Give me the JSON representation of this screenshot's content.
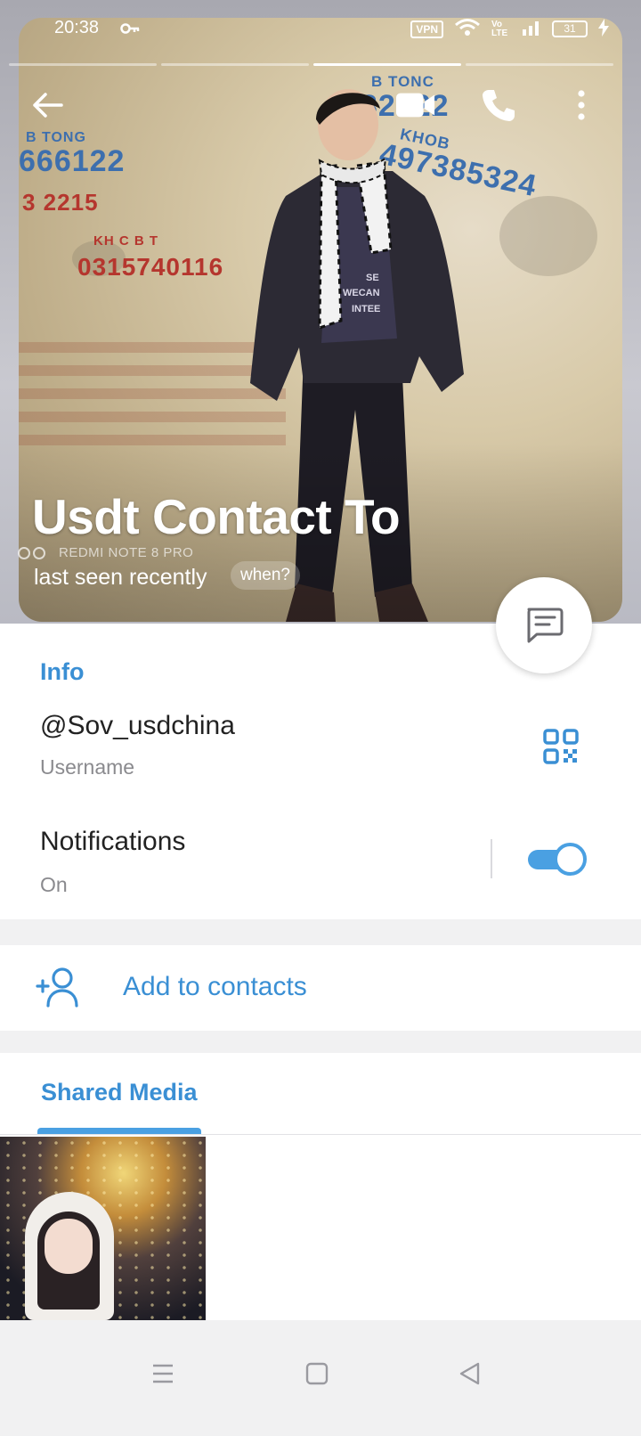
{
  "status_bar": {
    "time": "20:38",
    "vpn_label": "VPN",
    "volte_label": "Vo LTE",
    "battery_level": "31"
  },
  "profile": {
    "name": "Usdt Contact To",
    "last_seen": "last seen recently",
    "when_label": "when?",
    "photo_watermark": "REDMI NOTE 8 PRO",
    "graffiti": {
      "top_left_label": "B TONG",
      "top_left_number": "666122",
      "top_left_partial": "3 2215",
      "red_label": "KH C B T",
      "red_number": "0315740116",
      "top_right_label": "B TONC",
      "top_right_number": "32722",
      "blue_right_label": "KHOB",
      "blue_right_number": "497385324"
    },
    "shirt_text": [
      "SE",
      "WECAN",
      "INTEE"
    ],
    "story_segments": 4,
    "story_active_index": 2
  },
  "info": {
    "section_title": "Info",
    "username_value": "@Sov_usdchina",
    "username_caption": "Username",
    "notifications_label": "Notifications",
    "notifications_status": "On",
    "notifications_enabled": true
  },
  "contacts": {
    "add_label": "Add to contacts"
  },
  "media": {
    "tab_label": "Shared Media"
  },
  "colors": {
    "accent": "#3a8fd4",
    "toggle": "#4aa0e2",
    "secondary_text": "#8a8a8e"
  },
  "icons": {
    "back": "arrow-left-icon",
    "video_call": "video-camera-icon",
    "call": "phone-icon",
    "more": "more-vertical-icon",
    "message": "message-icon",
    "qr": "qr-code-icon",
    "add_contact": "add-person-icon"
  }
}
